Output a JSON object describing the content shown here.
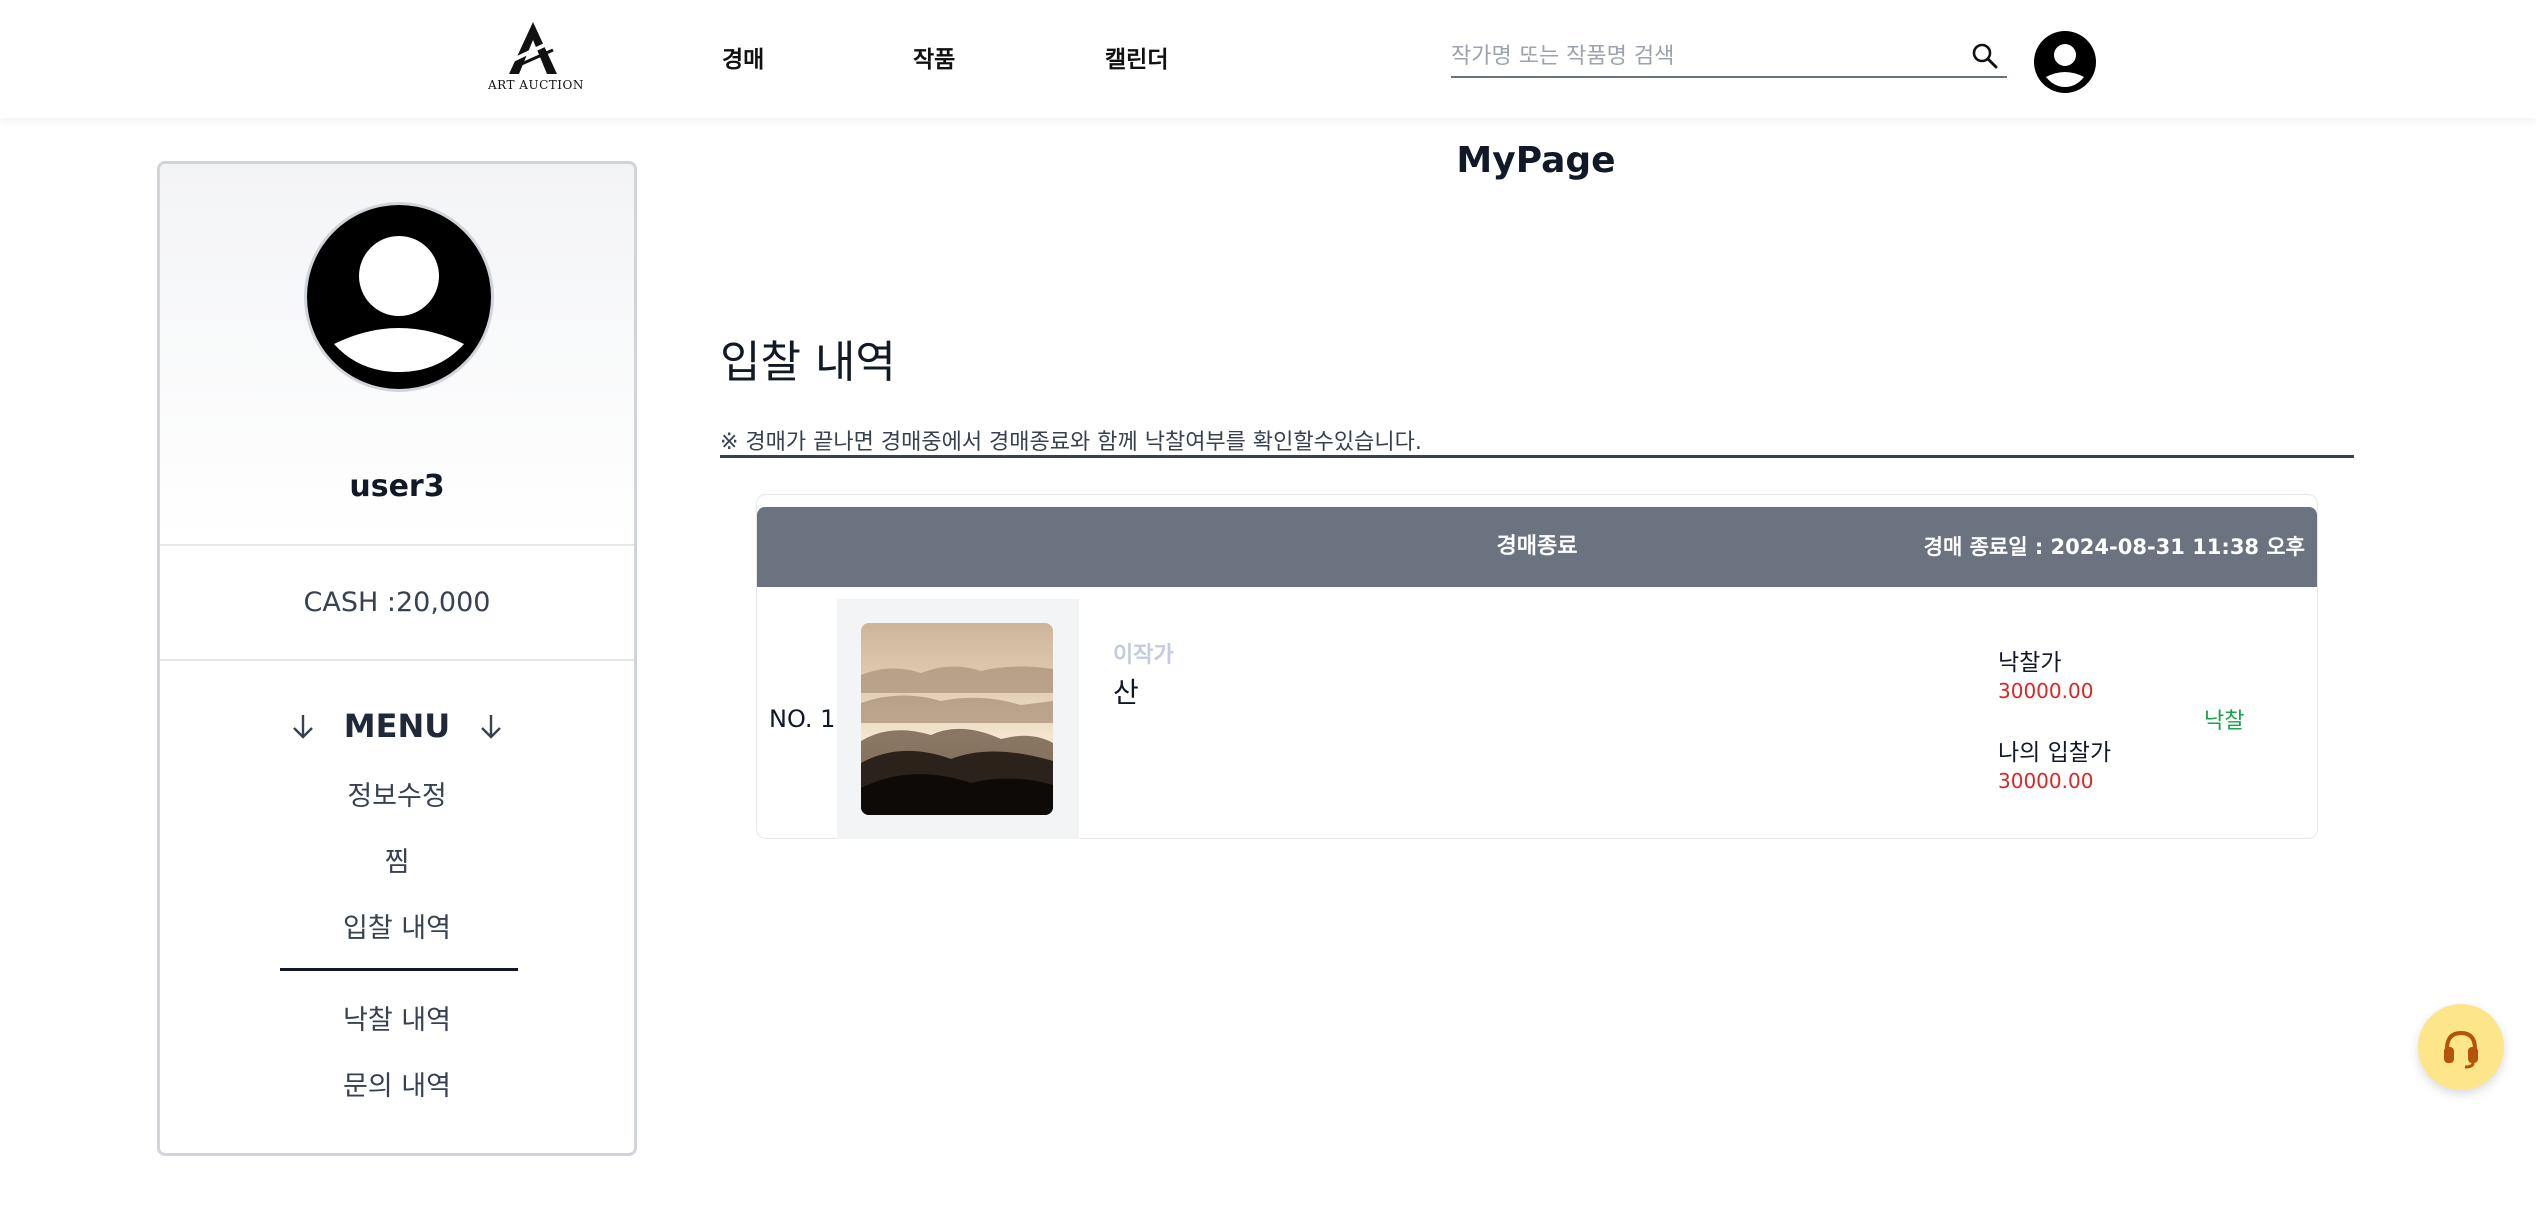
{
  "header": {
    "logo_text": "ART AUCTION",
    "nav": [
      "경매",
      "작품",
      "캘린더"
    ],
    "search_placeholder": "작가명 또는 작품명 검색"
  },
  "sidebar": {
    "username": "user3",
    "cash": "CASH :20,000",
    "menu_title": "MENU",
    "menu_items": [
      "정보수정",
      "찜",
      "입찰 내역",
      "낙찰 내역",
      "문의 내역"
    ],
    "active_item": "입찰 내역"
  },
  "main": {
    "page_title": "MyPage",
    "section_title": "입찰 내역",
    "note": "※ 경매가 끝나면 경매중에서 경매종료와 함께 낙찰여부를 확인할수있습니다.",
    "bids": [
      {
        "status": "경매종료",
        "end_date": "경매 종료일 : 2024-08-31 11:38 오후",
        "no": "NO. 1",
        "artist": "이작가",
        "title": "산",
        "winning_price_label": "낙찰가",
        "winning_price": "30000.00",
        "my_bid_label": "나의 입찰가",
        "my_bid": "30000.00",
        "result": "낙찰"
      }
    ]
  },
  "colors": {
    "header_bar": "#6b7280",
    "price": "#dc2626",
    "result": "#16a34a",
    "support_button": "#fde68a"
  },
  "icons": [
    "search-icon",
    "user-avatar-icon",
    "arrow-down-icon",
    "headset-icon"
  ]
}
